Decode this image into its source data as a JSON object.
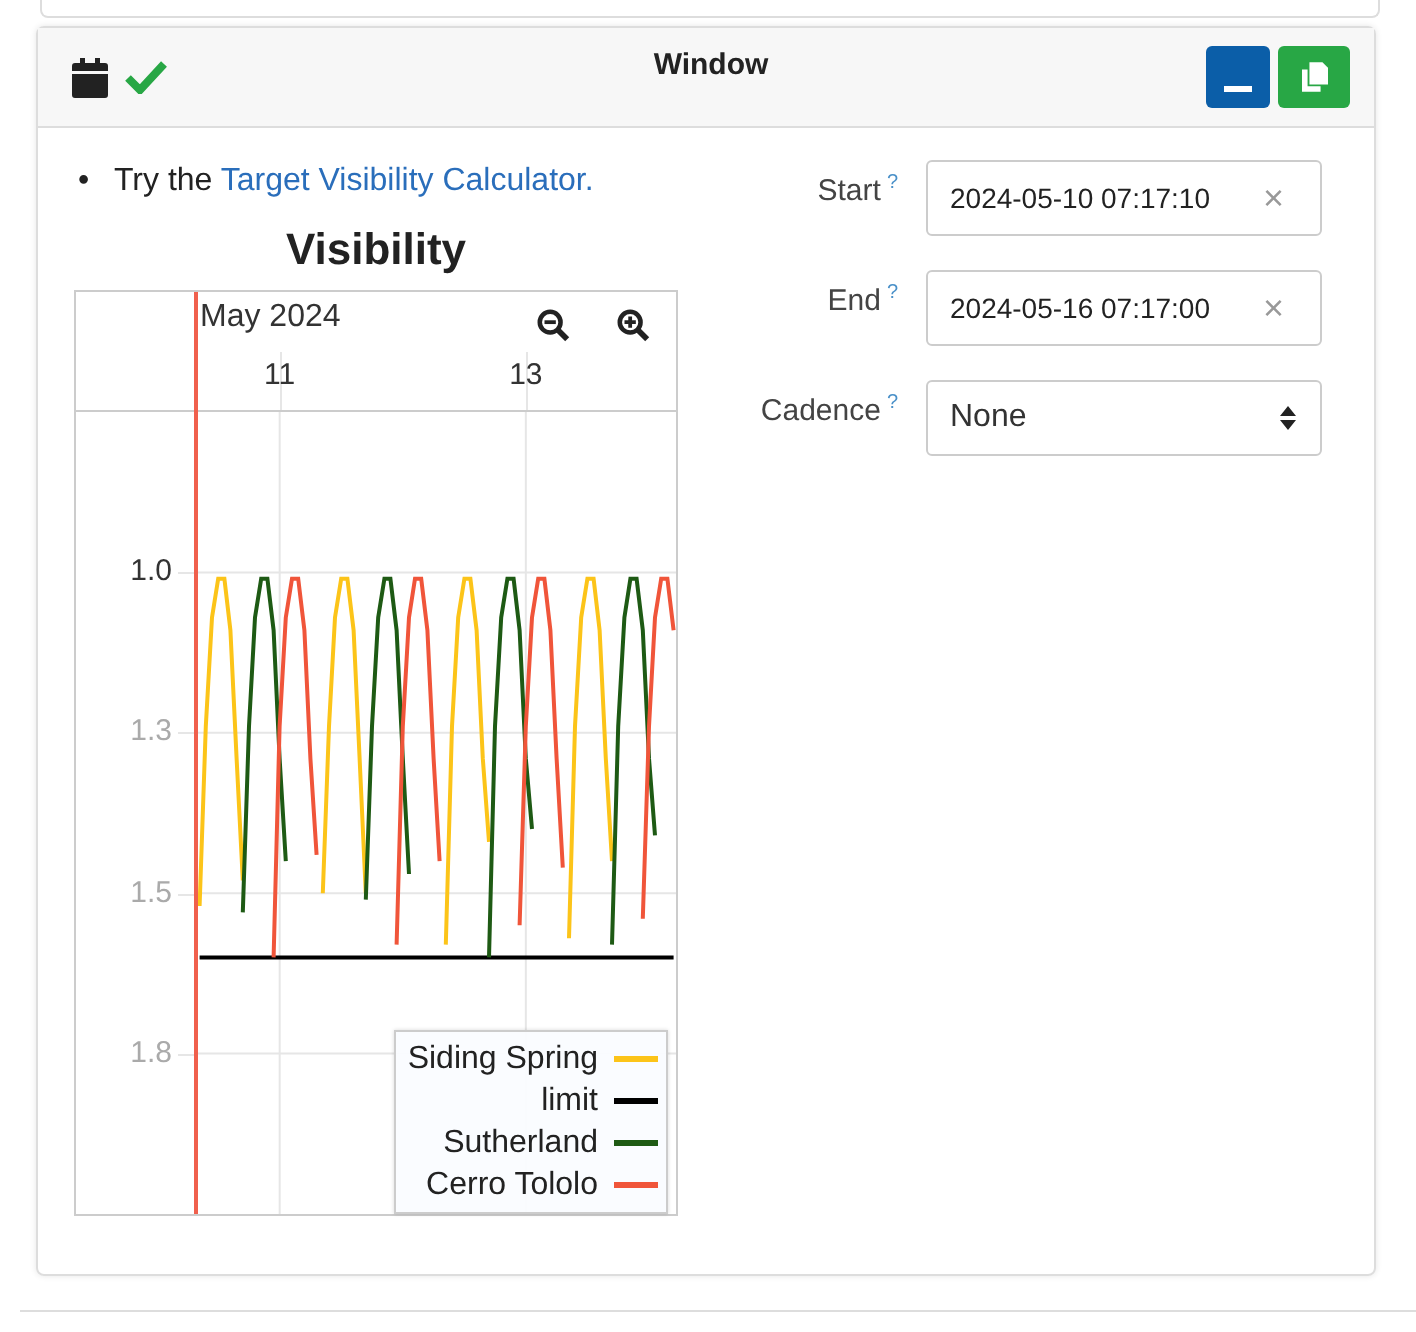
{
  "panel": {
    "title": "Window",
    "buttons": [
      {
        "kind": "minimize"
      },
      {
        "kind": "copy"
      }
    ]
  },
  "note": {
    "bullet": "•",
    "prefix": "Try the",
    "link": "Target Visibility Calculator."
  },
  "chart": {
    "period": "May 2024",
    "chart_data": {
      "type": "line",
      "title": "Visibility",
      "x": [
        10.35,
        10.4,
        10.45,
        10.5,
        10.55,
        10.6,
        10.65,
        10.7,
        10.75,
        10.8,
        10.85,
        10.9,
        10.95,
        11,
        11.05,
        11.1,
        11.15,
        11.2,
        11.25,
        11.3,
        11.35,
        11.4,
        11.45,
        11.5,
        11.55,
        11.6,
        11.65,
        11.7,
        11.75,
        11.8,
        11.85,
        11.9,
        11.95,
        12,
        12.05,
        12.1,
        12.15,
        12.2,
        12.25,
        12.3,
        12.35,
        12.4,
        12.45,
        12.5,
        12.55,
        12.6,
        12.65,
        12.7,
        12.75,
        12.8,
        12.85,
        12.9,
        12.95,
        13,
        13.05,
        13.1,
        13.15,
        13.2,
        13.25,
        13.3,
        13.35,
        13.4,
        13.45,
        13.5,
        13.55,
        13.6,
        13.65,
        13.7,
        13.75,
        13.8,
        13.85,
        13.9,
        13.95,
        14,
        14.05,
        14.1,
        14.15,
        14.2
      ],
      "series": [
        {
          "name": "Siding Spring",
          "color": "#fcc419",
          "values": [
            1.52,
            1.24,
            1.07,
            1.01,
            1.01,
            1.09,
            1.29,
            1.48,
            null,
            null,
            null,
            null,
            null,
            null,
            null,
            null,
            null,
            null,
            null,
            null,
            1.5,
            1.24,
            1.07,
            1.01,
            1.01,
            1.09,
            1.29,
            1.5,
            null,
            null,
            null,
            null,
            null,
            null,
            null,
            null,
            null,
            null,
            null,
            null,
            1.58,
            1.24,
            1.07,
            1.01,
            1.01,
            1.09,
            1.29,
            1.42,
            null,
            null,
            null,
            null,
            null,
            null,
            null,
            null,
            null,
            null,
            null,
            null,
            1.57,
            1.24,
            1.07,
            1.01,
            1.01,
            1.09,
            1.29,
            1.45,
            null,
            null,
            null,
            null,
            null,
            null,
            null,
            null,
            null,
            null
          ]
        },
        {
          "name": "limit",
          "color": "#000000",
          "values": [
            1.6,
            1.6,
            1.6,
            1.6,
            1.6,
            1.6,
            1.6,
            1.6,
            1.6,
            1.6,
            1.6,
            1.6,
            1.6,
            1.6,
            1.6,
            1.6,
            1.6,
            1.6,
            1.6,
            1.6,
            1.6,
            1.6,
            1.6,
            1.6,
            1.6,
            1.6,
            1.6,
            1.6,
            1.6,
            1.6,
            1.6,
            1.6,
            1.6,
            1.6,
            1.6,
            1.6,
            1.6,
            1.6,
            1.6,
            1.6,
            1.6,
            1.6,
            1.6,
            1.6,
            1.6,
            1.6,
            1.6,
            1.6,
            1.6,
            1.6,
            1.6,
            1.6,
            1.6,
            1.6,
            1.6,
            1.6,
            1.6,
            1.6,
            1.6,
            1.6,
            1.6,
            1.6,
            1.6,
            1.6,
            1.6,
            1.6,
            1.6,
            1.6,
            1.6,
            1.6,
            1.6,
            1.6,
            1.6,
            1.6,
            1.6,
            1.6,
            1.6,
            1.6
          ]
        },
        {
          "name": "Sutherland",
          "color": "#1e5a14",
          "values": [
            null,
            null,
            null,
            null,
            null,
            null,
            null,
            1.53,
            1.24,
            1.07,
            1.01,
            1.01,
            1.09,
            1.29,
            1.45,
            null,
            null,
            null,
            null,
            null,
            null,
            null,
            null,
            null,
            null,
            null,
            null,
            1.51,
            1.24,
            1.07,
            1.01,
            1.01,
            1.09,
            1.29,
            1.47,
            null,
            null,
            null,
            null,
            null,
            null,
            null,
            null,
            null,
            null,
            null,
            null,
            1.6,
            1.24,
            1.07,
            1.01,
            1.01,
            1.09,
            1.29,
            1.4,
            null,
            null,
            null,
            null,
            null,
            null,
            null,
            null,
            null,
            null,
            null,
            null,
            1.58,
            1.24,
            1.07,
            1.01,
            1.01,
            1.09,
            1.29,
            1.41,
            null,
            null,
            null
          ]
        },
        {
          "name": "Cerro Tololo",
          "color": "#f0553a",
          "values": [
            null,
            null,
            null,
            null,
            null,
            null,
            null,
            null,
            null,
            null,
            null,
            null,
            1.6,
            1.24,
            1.07,
            1.01,
            1.01,
            1.09,
            1.29,
            1.44,
            null,
            null,
            null,
            null,
            null,
            null,
            null,
            null,
            null,
            null,
            null,
            null,
            1.58,
            1.24,
            1.07,
            1.01,
            1.01,
            1.09,
            1.29,
            1.45,
            null,
            null,
            null,
            null,
            null,
            null,
            null,
            null,
            null,
            null,
            null,
            null,
            1.55,
            1.24,
            1.07,
            1.01,
            1.01,
            1.09,
            1.29,
            1.46,
            null,
            null,
            null,
            null,
            null,
            null,
            null,
            null,
            null,
            null,
            null,
            null,
            1.54,
            1.24,
            1.07,
            1.01,
            1.01,
            1.09
          ]
        }
      ],
      "xlim": [
        10.32,
        14.22
      ],
      "ylim": [
        2.0,
        0.75
      ],
      "xticks": [
        {
          "value": 11,
          "label": "11"
        },
        {
          "value": 13,
          "label": "13"
        }
      ],
      "yticks": [
        {
          "value": 1.0,
          "label": "1.0"
        },
        {
          "value": 1.25,
          "label": "1.3"
        },
        {
          "value": 1.5,
          "label": "1.5"
        },
        {
          "value": 1.75,
          "label": "1.8"
        }
      ],
      "grid": true,
      "legend": "lower right"
    }
  },
  "fields": [
    {
      "kind": "datetime",
      "label": "Start",
      "help": "?",
      "value": "2024-05-10 07:17:10",
      "clear": "×"
    },
    {
      "kind": "datetime",
      "label": "End",
      "help": "?",
      "value": "2024-05-16 07:17:00",
      "clear": "×"
    },
    {
      "kind": "select",
      "label": "Cadence",
      "help": "?",
      "value": "None"
    }
  ]
}
